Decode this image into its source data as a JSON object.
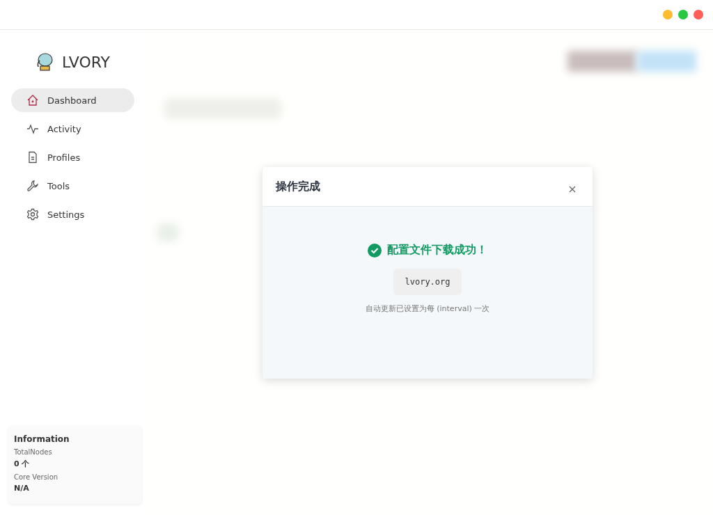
{
  "window_controls": [
    {
      "color": "#febc2e"
    },
    {
      "color": "#28c840"
    },
    {
      "color": "#ff5f57"
    }
  ],
  "app": {
    "name": "LVORY"
  },
  "sidebar": {
    "items": [
      {
        "label": "Dashboard",
        "kind": "home",
        "selected": true
      },
      {
        "label": "Activity",
        "kind": "activity",
        "selected": false
      },
      {
        "label": "Profiles",
        "kind": "file",
        "selected": false
      },
      {
        "label": "Tools",
        "kind": "wrench",
        "selected": false
      },
      {
        "label": "Settings",
        "kind": "gear",
        "selected": false
      }
    ]
  },
  "info": {
    "title": "Information",
    "fields": [
      {
        "label": "TotalNodes",
        "value": "0 个"
      },
      {
        "label": "Core Version",
        "value": "N/A"
      }
    ]
  },
  "dialog": {
    "title": "操作完成",
    "message": "配置文件下载成功！",
    "url": "lvory.org",
    "note": "自动更新已设置为每 (interval) 一次"
  }
}
